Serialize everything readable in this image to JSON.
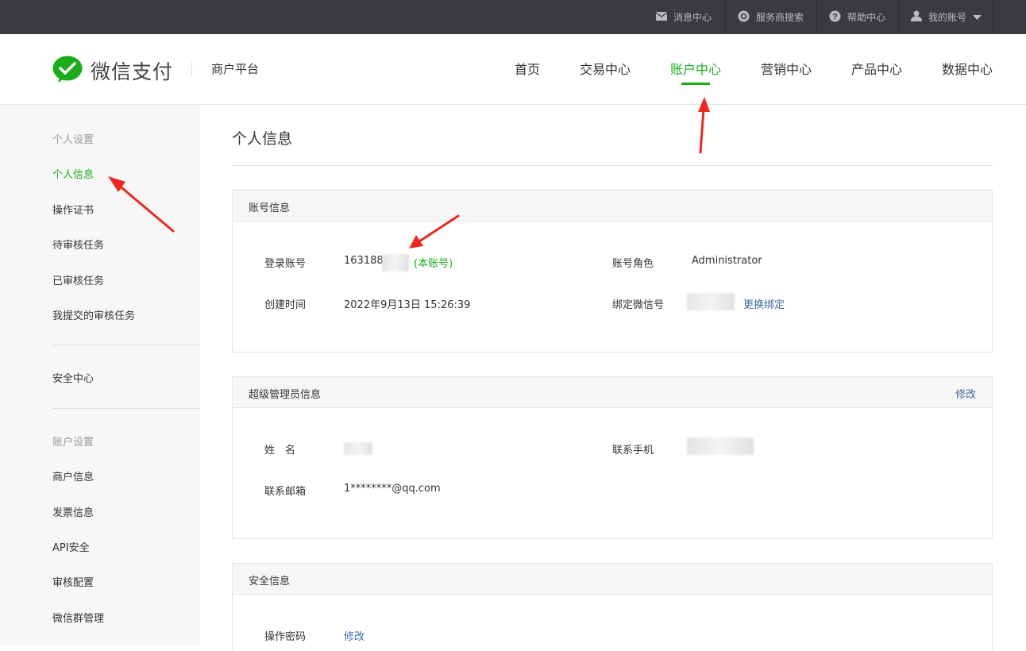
{
  "topbar": {
    "items": [
      {
        "label": "消息中心",
        "icon": "mail-icon"
      },
      {
        "label": "服务商搜索",
        "icon": "search-icon"
      },
      {
        "label": "帮助中心",
        "icon": "help-icon"
      },
      {
        "label": "我的账号",
        "icon": "user-icon"
      }
    ]
  },
  "header": {
    "logo_text": "微信支付",
    "subtitle": "商户平台",
    "nav": [
      "首页",
      "交易中心",
      "账户中心",
      "营销中心",
      "产品中心",
      "数据中心"
    ],
    "active_nav": "账户中心"
  },
  "sidebar": {
    "section1_title": "个人设置",
    "section1_items": [
      "个人信息",
      "操作证书",
      "待审核任务",
      "已审核任务",
      "我提交的审核任务"
    ],
    "security": "安全中心",
    "section2_title": "账户设置",
    "section2_items": [
      "商户信息",
      "发票信息",
      "API安全",
      "审核配置",
      "微信群管理"
    ]
  },
  "main": {
    "title": "个人信息",
    "account": {
      "header": "账号信息",
      "login_label": "登录账号",
      "login_value": "163188",
      "login_note": "(本账号)",
      "role_label": "账号角色",
      "role_value": "Administrator",
      "created_label": "创建时间",
      "created_value": "2022年9月13日 15:26:39",
      "wechat_label": "绑定微信号",
      "wechat_action": "更换绑定"
    },
    "admin": {
      "header": "超级管理员信息",
      "edit": "修改",
      "name_label": "姓　名",
      "phone_label": "联系手机",
      "email_label": "联系邮箱",
      "email_value": "1********@qq.com"
    },
    "security": {
      "header": "安全信息",
      "pwd_label": "操作密码",
      "pwd_action": "修改"
    }
  },
  "colors": {
    "accent": "#1aad19",
    "link": "#3e6aa5",
    "topbar": "#3a3b3e",
    "arrow": "#f0261f"
  }
}
